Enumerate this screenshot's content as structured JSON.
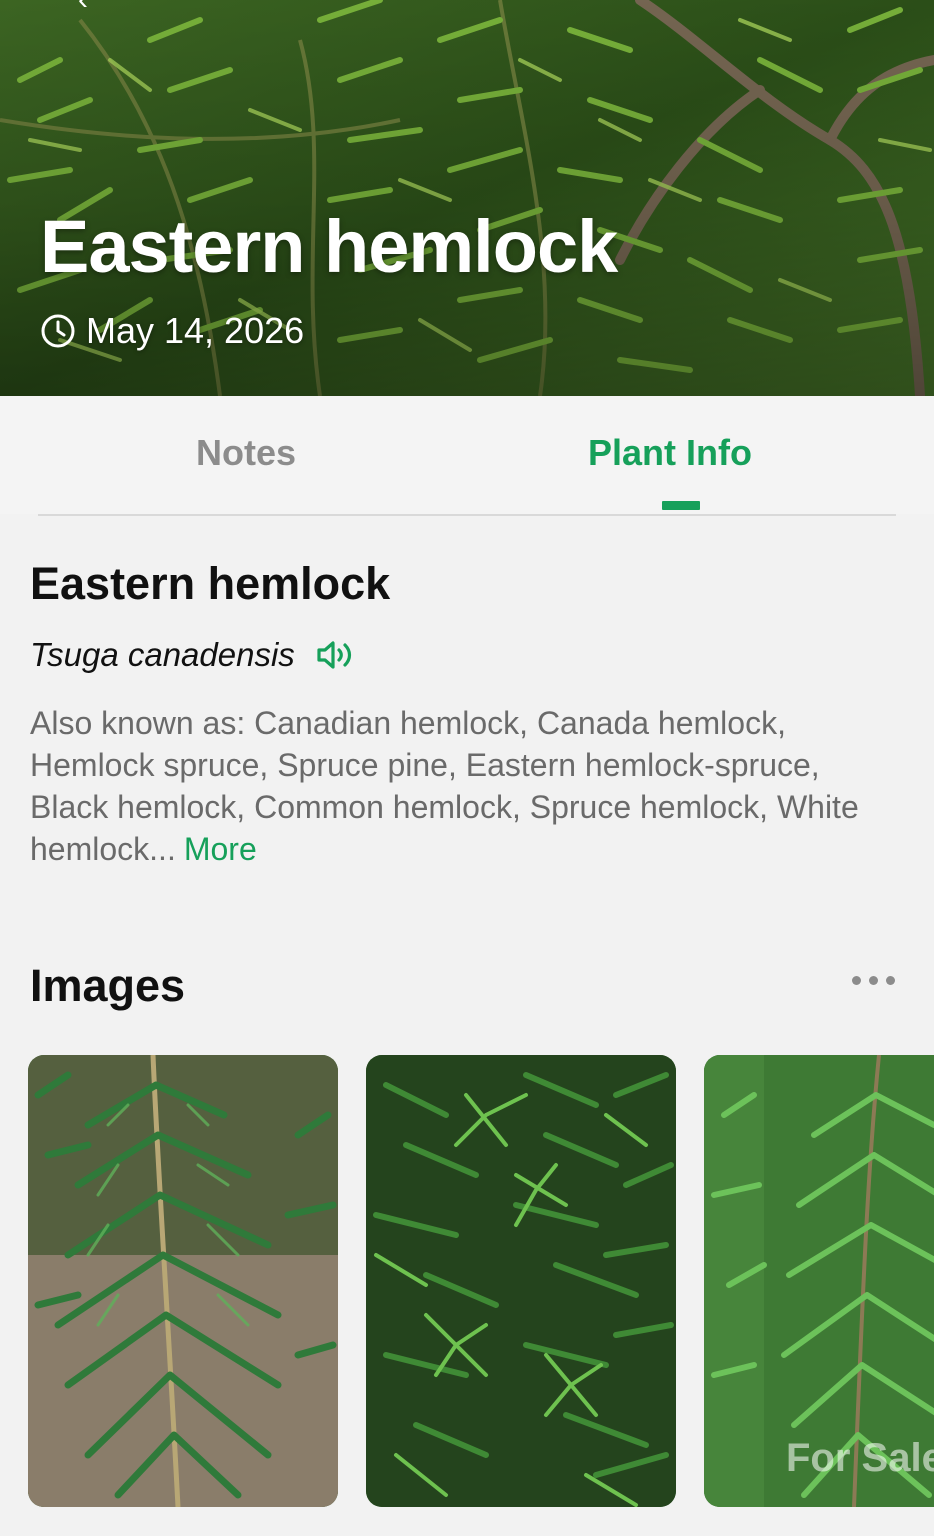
{
  "hero": {
    "back_glyph": "‹",
    "title": "Eastern hemlock",
    "date": "May 14, 2026",
    "date_icon": "clock-icon"
  },
  "tabs": {
    "notes_label": "Notes",
    "info_label": "Plant Info",
    "active": "Plant Info"
  },
  "plant": {
    "name": "Eastern hemlock",
    "scientific_name": "Tsuga canadensis",
    "pronounce_icon": "speaker-icon",
    "also_known_as": "Also known as: Canadian hemlock, Canada hemlock, Hemlock spruce, Spruce pine, Eastern hemlock-spruce, Black hemlock, Common hemlock, Spruce hemlock, White hemlock...",
    "more_label": "More"
  },
  "images": {
    "title": "Images",
    "menu_icon": "more-dots-icon",
    "watermark": "For Sale"
  },
  "colors": {
    "accent": "#16a05a",
    "muted_text": "#6a6a6a",
    "background": "#f2f2f2"
  }
}
